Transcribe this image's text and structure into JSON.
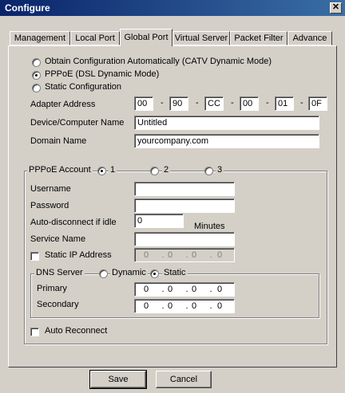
{
  "window": {
    "title": "Configure",
    "close_glyph": "✕"
  },
  "tabs": [
    "Management",
    "Local Port",
    "Global Port",
    "Virtual Server",
    "Packet Filter",
    "Advance"
  ],
  "active_tab": "Global Port",
  "mode": {
    "options": [
      "Obtain Configuration Automatically (CATV Dynamic Mode)",
      "PPPoE (DSL Dynamic Mode)",
      "Static Configuration"
    ],
    "selected": "PPPoE (DSL Dynamic Mode)"
  },
  "adapter": {
    "label": "Adapter Address",
    "octets": [
      "00",
      "90",
      "CC",
      "00",
      "01",
      "0F"
    ],
    "separator": "-"
  },
  "device": {
    "label": "Device/Computer Name",
    "value": "Untitled"
  },
  "domain": {
    "label": "Domain Name",
    "value": "yourcompany.com"
  },
  "pppoe": {
    "legend": "PPPoE Account",
    "accounts": [
      "1",
      "2",
      "3"
    ],
    "selected_account": "1",
    "username": {
      "label": "Username",
      "value": ""
    },
    "password": {
      "label": "Password",
      "value": ""
    },
    "idle": {
      "label": "Auto-disconnect if idle",
      "value": "0",
      "unit": "Minutes"
    },
    "service": {
      "label": "Service Name",
      "value": ""
    },
    "static_ip": {
      "label": "Static IP Address",
      "checked": false,
      "octets": [
        "0",
        "0",
        "0",
        "0"
      ]
    },
    "dns": {
      "legend": "DNS Server",
      "options": [
        "Dynamic",
        "Static"
      ],
      "selected": "Static",
      "primary": {
        "label": "Primary",
        "octets": [
          "0",
          "0",
          "0",
          "0"
        ]
      },
      "secondary": {
        "label": "Secondary",
        "octets": [
          "0",
          "0",
          "0",
          "0"
        ]
      }
    },
    "auto_reconnect": {
      "label": "Auto Reconnect",
      "checked": false
    }
  },
  "buttons": {
    "save": "Save",
    "cancel": "Cancel"
  },
  "icons": {
    "close": "close-icon"
  },
  "colors": {
    "face": "#d4d0c8",
    "title_start": "#0a246a",
    "title_end": "#3a6ea5"
  }
}
